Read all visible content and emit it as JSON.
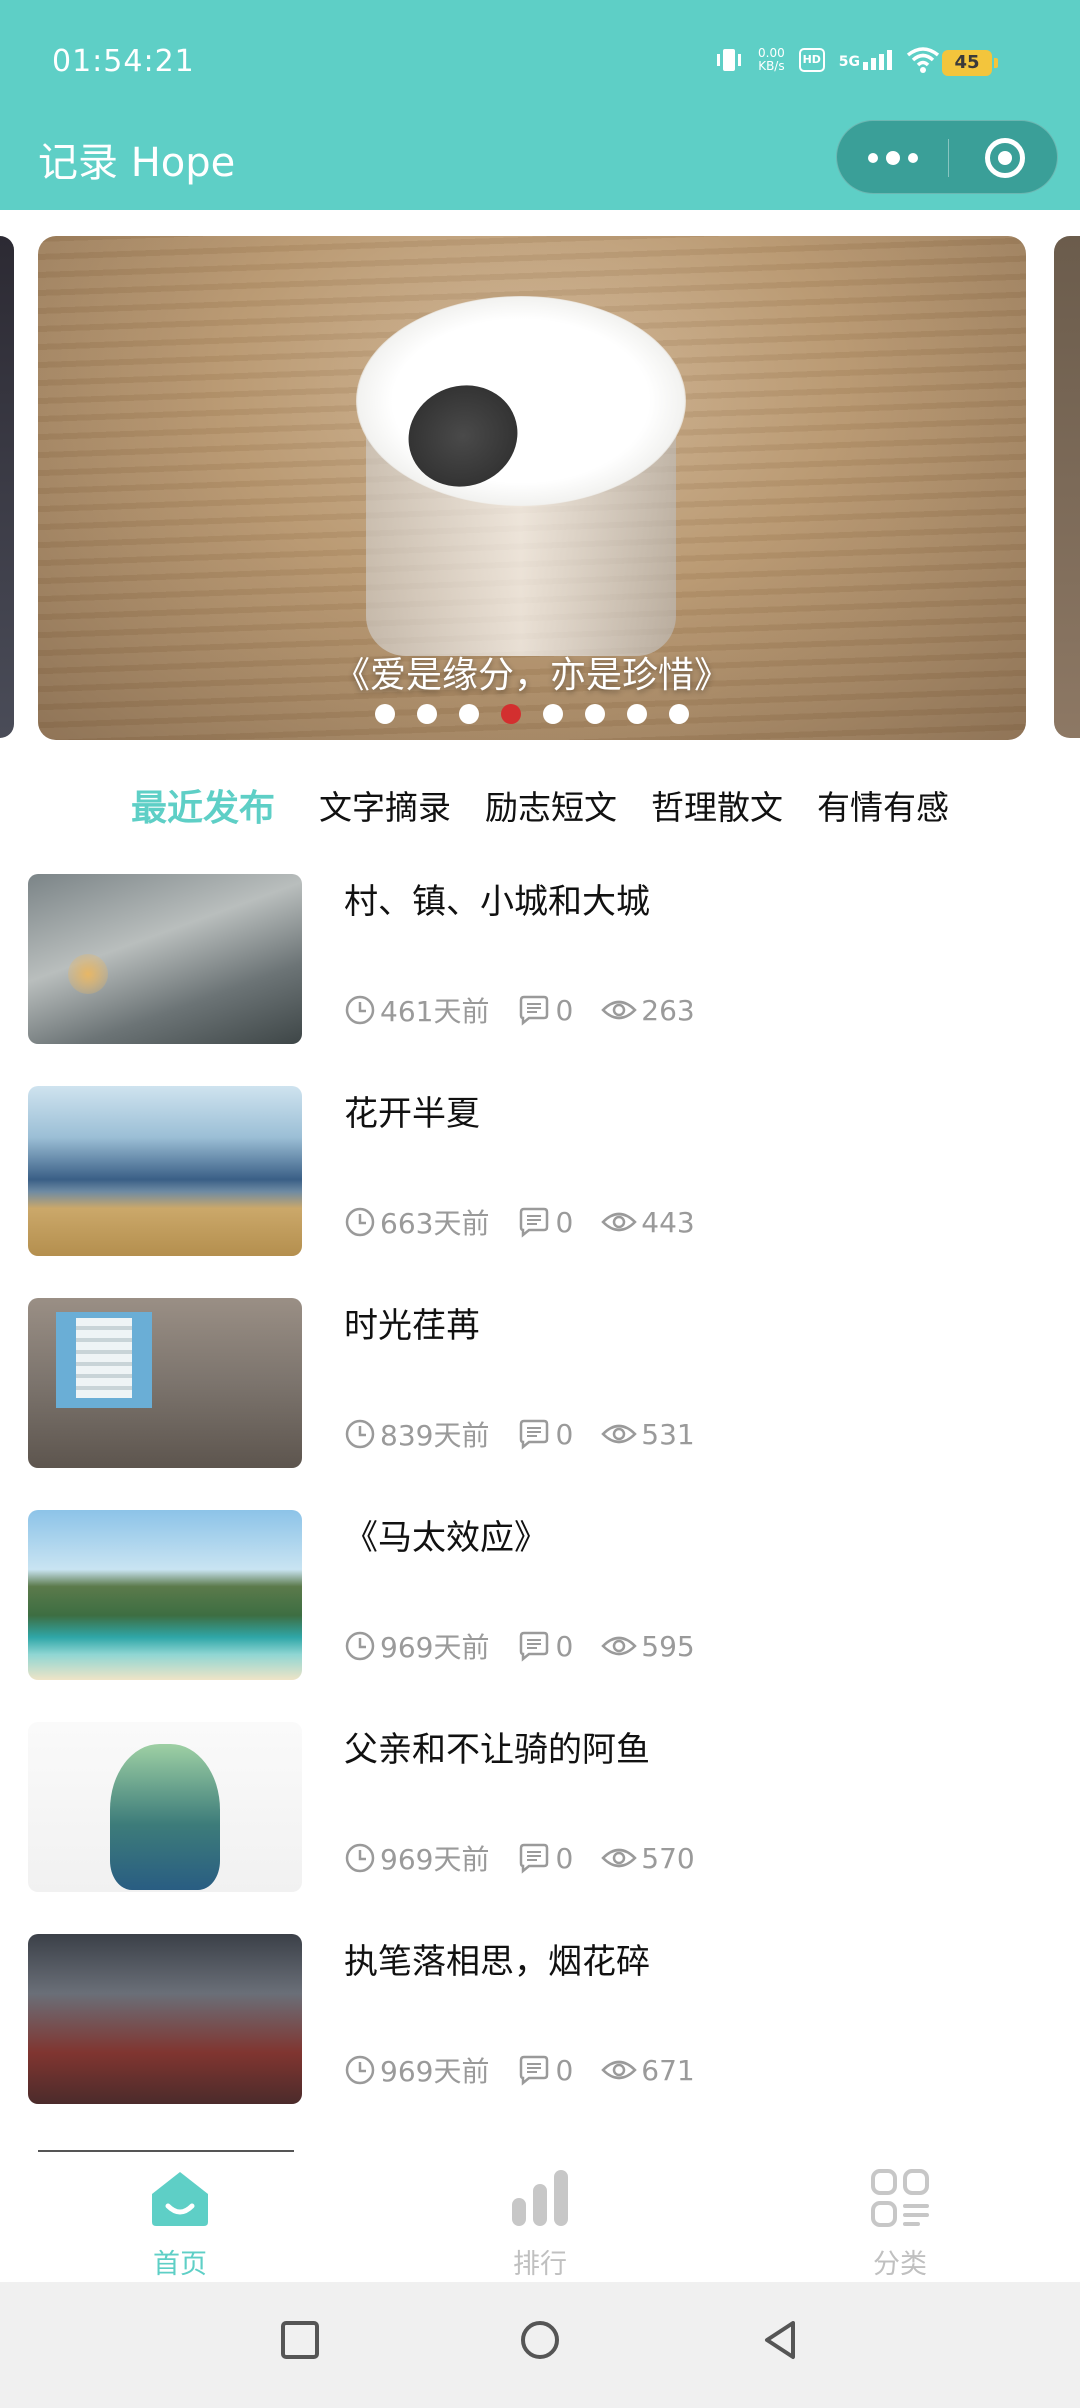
{
  "status_bar": {
    "time": "01:54:21",
    "speed_value": "0.00",
    "speed_unit": "KB/s",
    "hd": "HD",
    "network": "5G",
    "battery": "45"
  },
  "navbar": {
    "title": "记录 Hope"
  },
  "banner": {
    "caption": "《爱是缘分，亦是珍惜》",
    "dot_count": 8,
    "active_dot": 4
  },
  "tabs": [
    {
      "label": "最近发布",
      "active": true
    },
    {
      "label": "文字摘录",
      "active": false
    },
    {
      "label": "励志短文",
      "active": false
    },
    {
      "label": "哲理散文",
      "active": false
    },
    {
      "label": "有情有感",
      "active": false
    }
  ],
  "articles": [
    {
      "title": "村、镇、小城和大城",
      "time": "461天前",
      "comments": "0",
      "views": "263"
    },
    {
      "title": "花开半夏",
      "time": "663天前",
      "comments": "0",
      "views": "443"
    },
    {
      "title": "时光荏苒",
      "time": "839天前",
      "comments": "0",
      "views": "531"
    },
    {
      "title": "《马太效应》",
      "time": "969天前",
      "comments": "0",
      "views": "595"
    },
    {
      "title": "父亲和不让骑的阿鱼",
      "time": "969天前",
      "comments": "0",
      "views": "570"
    },
    {
      "title": "执笔落相思，烟花碎",
      "time": "969天前",
      "comments": "0",
      "views": "671"
    }
  ],
  "tabbar": {
    "home": "首页",
    "ranking": "排行",
    "category": "分类"
  },
  "colors": {
    "accent": "#5ecfc6",
    "active_dot": "#d32f2f",
    "meta_text": "#9a9a9a"
  }
}
